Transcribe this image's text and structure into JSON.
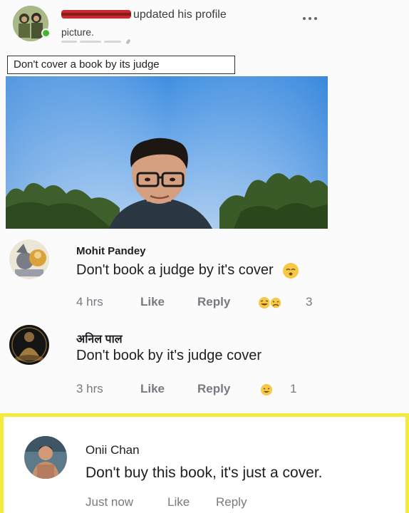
{
  "post": {
    "header_action": "updated his profile",
    "header_action_cont": "picture.",
    "caption": "Don't cover a book by its judge",
    "more_icon": "more-horizontal-icon"
  },
  "comments": [
    {
      "name": "Mohit Pandey",
      "text": "Don't book a judge by it's cover",
      "time": "4 hrs",
      "like": "Like",
      "reply": "Reply",
      "reaction_count": "3"
    },
    {
      "name": "अनिल पाल",
      "text": "Don't book by it's judge cover",
      "time": "3 hrs",
      "like": "Like",
      "reply": "Reply",
      "reaction_count": "1"
    },
    {
      "name": "Onii Chan",
      "text": "Don't buy this book, it's just a cover.",
      "time": "Just now",
      "like": "Like",
      "reply": "Reply"
    }
  ],
  "colors": {
    "highlight": "#f3ec3e",
    "meta_text": "#777a80",
    "reaction_yellow": "#f7c844"
  }
}
